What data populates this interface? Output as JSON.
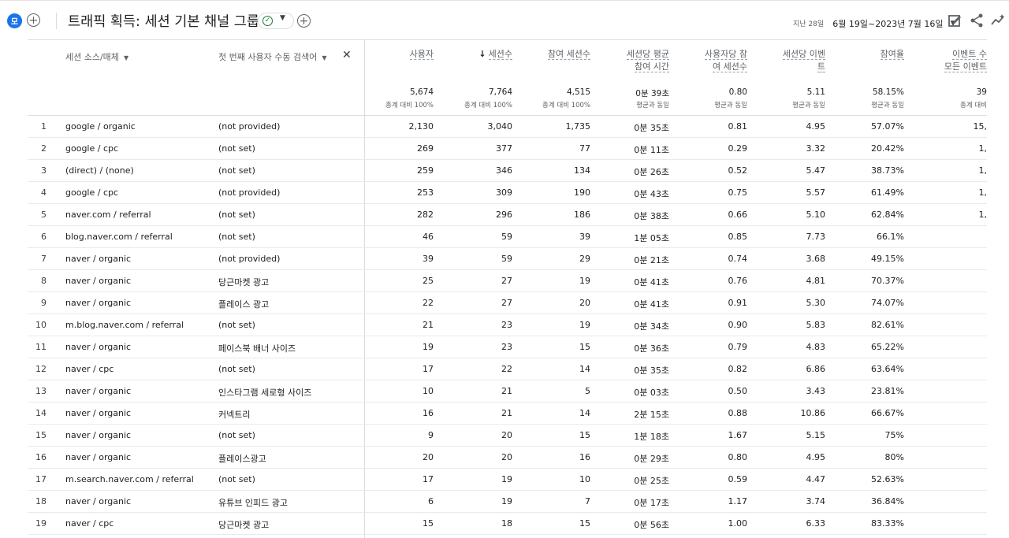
{
  "header": {
    "avatar_label": "모",
    "title": "트래픽 획득: 세션 기본 채널 그룹",
    "date_prefix": "지난 28일",
    "date_range": "6월 19일~2023년 7월 16일"
  },
  "icons": {
    "add_compare": "plus-circle-icon",
    "title_check": "check-circle-icon",
    "customize": "edit-report-icon",
    "share": "share-icon",
    "insights": "insights-icon"
  },
  "table": {
    "dim1_header": "세션 소스/매체",
    "dim2_header": "첫 번째 사용자 수동 검색어",
    "metric_headers": [
      {
        "label1": "사용자",
        "label2": ""
      },
      {
        "label1": "세션수",
        "label2": ""
      },
      {
        "label1": "참여 세션수",
        "label2": ""
      },
      {
        "label1": "세션당 평균",
        "label2": "참여 시간"
      },
      {
        "label1": "사용자당 참",
        "label2": "여 세션수"
      },
      {
        "label1": "세션당 이벤",
        "label2": "트"
      },
      {
        "label1": "참여율",
        "label2": ""
      },
      {
        "label1": "이벤트 수",
        "label2": "모든 이벤트"
      }
    ],
    "totals": [
      {
        "value": "5,674",
        "sub": "총계 대비 100%"
      },
      {
        "value": "7,764",
        "sub": "총계 대비 100%"
      },
      {
        "value": "4,515",
        "sub": "총계 대비 100%"
      },
      {
        "value": "0분 39초",
        "sub": "평균과 동일"
      },
      {
        "value": "0.80",
        "sub": "평균과 동일"
      },
      {
        "value": "5.11",
        "sub": "평균과 동일"
      },
      {
        "value": "58.15%",
        "sub": "평균과 동일"
      },
      {
        "value": "39",
        "sub": "총계 대비"
      }
    ],
    "rows": [
      {
        "idx": "1",
        "src": "google / organic",
        "kw": "(not provided)",
        "m": [
          "2,130",
          "3,040",
          "1,735",
          "0분 35초",
          "0.81",
          "4.95",
          "57.07%",
          "15,"
        ]
      },
      {
        "idx": "2",
        "src": "google / cpc",
        "kw": "(not set)",
        "m": [
          "269",
          "377",
          "77",
          "0분 11초",
          "0.29",
          "3.32",
          "20.42%",
          "1,"
        ]
      },
      {
        "idx": "3",
        "src": "(direct) / (none)",
        "kw": "(not set)",
        "m": [
          "259",
          "346",
          "134",
          "0분 26초",
          "0.52",
          "5.47",
          "38.73%",
          "1,"
        ]
      },
      {
        "idx": "4",
        "src": "google / cpc",
        "kw": "(not provided)",
        "m": [
          "253",
          "309",
          "190",
          "0분 43초",
          "0.75",
          "5.57",
          "61.49%",
          "1,"
        ]
      },
      {
        "idx": "5",
        "src": "naver.com / referral",
        "kw": "(not set)",
        "m": [
          "282",
          "296",
          "186",
          "0분 38초",
          "0.66",
          "5.10",
          "62.84%",
          "1,"
        ]
      },
      {
        "idx": "6",
        "src": "blog.naver.com / referral",
        "kw": "(not set)",
        "m": [
          "46",
          "59",
          "39",
          "1분 05초",
          "0.85",
          "7.73",
          "66.1%",
          ""
        ]
      },
      {
        "idx": "7",
        "src": "naver / organic",
        "kw": "(not provided)",
        "m": [
          "39",
          "59",
          "29",
          "0분 21초",
          "0.74",
          "3.68",
          "49.15%",
          ""
        ]
      },
      {
        "idx": "8",
        "src": "naver / organic",
        "kw": "당근마켓 광고",
        "m": [
          "25",
          "27",
          "19",
          "0분 41초",
          "0.76",
          "4.81",
          "70.37%",
          ""
        ]
      },
      {
        "idx": "9",
        "src": "naver / organic",
        "kw": "플레이스 광고",
        "m": [
          "22",
          "27",
          "20",
          "0분 41초",
          "0.91",
          "5.30",
          "74.07%",
          ""
        ]
      },
      {
        "idx": "10",
        "src": "m.blog.naver.com / referral",
        "kw": "(not set)",
        "m": [
          "21",
          "23",
          "19",
          "0분 34초",
          "0.90",
          "5.83",
          "82.61%",
          ""
        ]
      },
      {
        "idx": "11",
        "src": "naver / organic",
        "kw": "페이스북 배너 사이즈",
        "m": [
          "19",
          "23",
          "15",
          "0분 36초",
          "0.79",
          "4.83",
          "65.22%",
          ""
        ]
      },
      {
        "idx": "12",
        "src": "naver / cpc",
        "kw": "(not set)",
        "m": [
          "17",
          "22",
          "14",
          "0분 35초",
          "0.82",
          "6.86",
          "63.64%",
          ""
        ]
      },
      {
        "idx": "13",
        "src": "naver / organic",
        "kw": "인스타그램 세로형 사이즈",
        "m": [
          "10",
          "21",
          "5",
          "0분 03초",
          "0.50",
          "3.43",
          "23.81%",
          ""
        ]
      },
      {
        "idx": "14",
        "src": "naver / organic",
        "kw": "커넥트리",
        "m": [
          "16",
          "21",
          "14",
          "2분 15초",
          "0.88",
          "10.86",
          "66.67%",
          ""
        ]
      },
      {
        "idx": "15",
        "src": "naver / organic",
        "kw": "(not set)",
        "m": [
          "9",
          "20",
          "15",
          "1분 18초",
          "1.67",
          "5.15",
          "75%",
          ""
        ]
      },
      {
        "idx": "16",
        "src": "naver / organic",
        "kw": "플레이스광고",
        "m": [
          "20",
          "20",
          "16",
          "0분 29초",
          "0.80",
          "4.95",
          "80%",
          ""
        ]
      },
      {
        "idx": "17",
        "src": "m.search.naver.com / referral",
        "kw": "(not set)",
        "m": [
          "17",
          "19",
          "10",
          "0분 25초",
          "0.59",
          "4.47",
          "52.63%",
          ""
        ]
      },
      {
        "idx": "18",
        "src": "naver / organic",
        "kw": "유튜브 인피드 광고",
        "m": [
          "6",
          "19",
          "7",
          "0분 17초",
          "1.17",
          "3.74",
          "36.84%",
          ""
        ]
      },
      {
        "idx": "19",
        "src": "naver / cpc",
        "kw": "당근마켓 광고",
        "m": [
          "15",
          "18",
          "15",
          "0분 56초",
          "1.00",
          "6.33",
          "83.33%",
          ""
        ]
      }
    ]
  }
}
